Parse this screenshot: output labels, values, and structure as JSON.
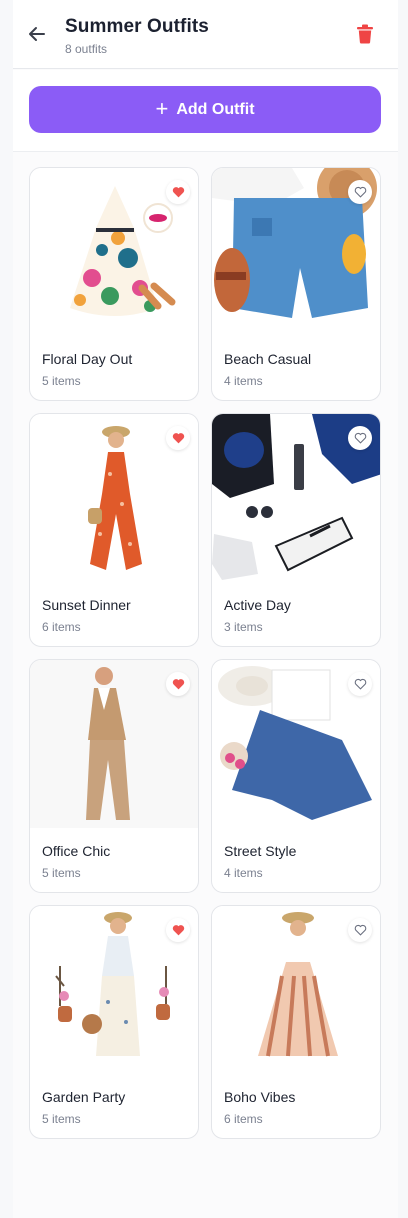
{
  "header": {
    "title": "Summer Outfits",
    "subtitle": "8 outfits",
    "back_icon": "arrow-left-icon",
    "delete_icon": "trash-icon"
  },
  "actions": {
    "add_label": "Add Outfit",
    "add_icon": "plus-icon"
  },
  "colors": {
    "accent": "#8b5cf6",
    "danger": "#ef4444",
    "favorite": "#ef5350"
  },
  "outfits": [
    {
      "name": "Floral Day Out",
      "count": "5 items",
      "favorite": true
    },
    {
      "name": "Beach Casual",
      "count": "4 items",
      "favorite": false
    },
    {
      "name": "Sunset Dinner",
      "count": "6 items",
      "favorite": true
    },
    {
      "name": "Active Day",
      "count": "3 items",
      "favorite": false
    },
    {
      "name": "Office Chic",
      "count": "5 items",
      "favorite": true
    },
    {
      "name": "Street Style",
      "count": "4 items",
      "favorite": false
    },
    {
      "name": "Garden Party",
      "count": "5 items",
      "favorite": true
    },
    {
      "name": "Boho Vibes",
      "count": "6 items",
      "favorite": false
    }
  ]
}
